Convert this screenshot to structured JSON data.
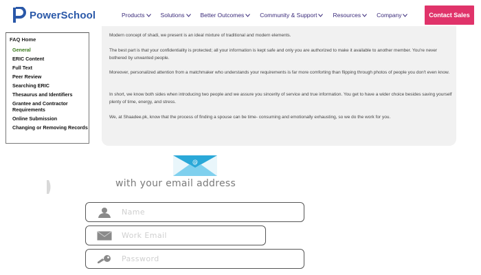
{
  "header": {
    "logo_text": "PowerSchool",
    "nav": [
      {
        "label": "Products"
      },
      {
        "label": "Solutions"
      },
      {
        "label": "Better Outcomes"
      },
      {
        "label": "Community & Support"
      },
      {
        "label": "Resources"
      },
      {
        "label": "Company"
      }
    ],
    "cta_label": "Contact Sales",
    "colors": {
      "brand": "#2a58a8",
      "nav": "#3a2a7a",
      "cta": "#e0336a"
    }
  },
  "sidebar": {
    "home_label": "FAQ Home",
    "items": [
      {
        "label": "General",
        "active": true
      },
      {
        "label": "ERIC Content"
      },
      {
        "label": "Full Text"
      },
      {
        "label": "Peer Review"
      },
      {
        "label": "Searching ERIC"
      },
      {
        "label": "Thesaurus and Identifiers"
      },
      {
        "label": "Grantee and Contractor Requirements"
      },
      {
        "label": "Online Submission"
      },
      {
        "label": "Changing or Removing Records"
      }
    ],
    "active_color": "#3b7a1c"
  },
  "content": {
    "paragraphs": [
      "Modern concept of shadi, we present is an ideal mixture of traditional and modern elements.",
      "The best part is that your confidentiality is protected; all your information is kept safe and only you are authorized to make it available to another member. You're never bothered by unwanted people.",
      "Moreover, personalized attention from a matchmaker who understands your requirements is far more comforting than flipping through photos of people you don't even know.",
      "In short, we know both sides when introducing two people and we assure you sincerity of service and true information. You get to have a wider choice besides saving yourself plenty of time, energy, and stress.",
      "We, at Shaadee.pk, know that the process of finding a spouse can be time- consuming and emotionally exhausting, so we do the work for you."
    ]
  },
  "signup": {
    "envelope_icon": "envelope-at-icon",
    "heading": "with your email address",
    "fields": {
      "name_placeholder": "Name",
      "email_placeholder": "Work Email",
      "password_placeholder": "Password"
    },
    "icons": {
      "name": "user-icon",
      "email": "mail-icon",
      "password": "key-icon"
    }
  }
}
